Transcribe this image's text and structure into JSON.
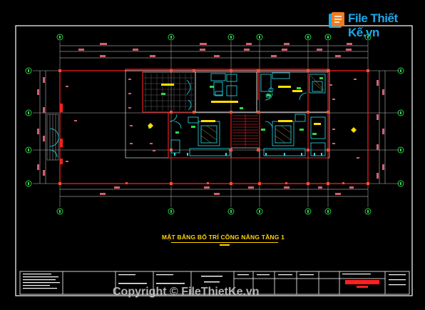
{
  "drawing": {
    "plan_title": "MẶT BẰNG BỐ TRÍ CÔNG NĂNG TẦNG 1",
    "colors": {
      "background": "#000000",
      "frame": "#ffffff",
      "walls": "#ff2020",
      "grid_axis": "#ffffff",
      "bubble": "#2fd84a",
      "furniture": "#27e0ee",
      "dimension": "#d06070",
      "title": "#ffd400"
    },
    "grid_columns": 8,
    "grid_rows": 4
  },
  "watermark": {
    "brand": "File Thiết Kế.vn",
    "copyright": "Copyright © FileThietKe.vn"
  }
}
